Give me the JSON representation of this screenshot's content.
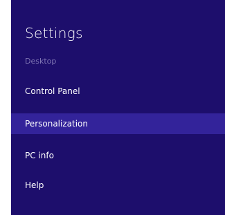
{
  "settings": {
    "title": "Settings",
    "subtitle": "Desktop",
    "items": [
      {
        "label": "Control Panel"
      },
      {
        "label": "Personalization"
      },
      {
        "label": "PC info"
      },
      {
        "label": "Help"
      }
    ],
    "selected_item": "Personalization"
  },
  "colors": {
    "background": "#1d0e6c",
    "selected": "#33239a",
    "subtitle": "#7f75b3",
    "text": "#ffffff"
  }
}
